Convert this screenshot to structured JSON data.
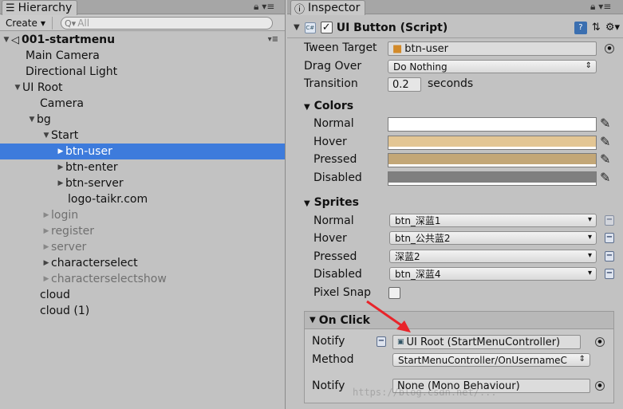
{
  "hierarchy": {
    "tab_label": "Hierarchy",
    "create_label": "Create",
    "search_placeholder": "All",
    "scene_name": "001-startmenu",
    "items": [
      {
        "label": "Main Camera"
      },
      {
        "label": "Directional Light"
      },
      {
        "label": "UI Root"
      },
      {
        "label": "Camera"
      },
      {
        "label": "bg"
      },
      {
        "label": "Start"
      },
      {
        "label": "btn-user"
      },
      {
        "label": "btn-enter"
      },
      {
        "label": "btn-server"
      },
      {
        "label": "logo-taikr.com"
      },
      {
        "label": "login"
      },
      {
        "label": "register"
      },
      {
        "label": "server"
      },
      {
        "label": "characterselect"
      },
      {
        "label": "characterselectshow"
      },
      {
        "label": "cloud"
      },
      {
        "label": "cloud (1)"
      }
    ]
  },
  "inspector": {
    "tab_label": "Inspector",
    "component_title": "UI Button (Script)",
    "tween_target": {
      "label": "Tween Target",
      "value": "btn-user"
    },
    "drag_over": {
      "label": "Drag Over",
      "value": "Do Nothing"
    },
    "transition": {
      "label": "Transition",
      "value": "0.2",
      "unit": "seconds"
    },
    "colors": {
      "section": "Colors",
      "rows": [
        {
          "label": "Normal",
          "color": "#ffffff"
        },
        {
          "label": "Hover",
          "color": "#e3c694"
        },
        {
          "label": "Pressed",
          "color": "#c3a777"
        },
        {
          "label": "Disabled",
          "color": "#7f7f7f"
        }
      ]
    },
    "sprites": {
      "section": "Sprites",
      "rows": [
        {
          "label": "Normal",
          "value": "btn_深蓝1"
        },
        {
          "label": "Hover",
          "value": "btn_公共蓝2"
        },
        {
          "label": "Pressed",
          "value": "深蓝2"
        },
        {
          "label": "Disabled",
          "value": "btn_深蓝4"
        }
      ],
      "pixel_snap_label": "Pixel Snap"
    },
    "on_click": {
      "section": "On Click",
      "notify_label": "Notify",
      "notify_value": "UI Root (StartMenuController)",
      "method_label": "Method",
      "method_value": "StartMenuController/OnUsernameC",
      "notify2_label": "Notify",
      "notify2_value": "None (Mono Behaviour)"
    },
    "watermark": "https://blog.csdn.net/..."
  },
  "colors": {
    "selection": "#3d7bdc",
    "arrow": "#e8242a"
  }
}
